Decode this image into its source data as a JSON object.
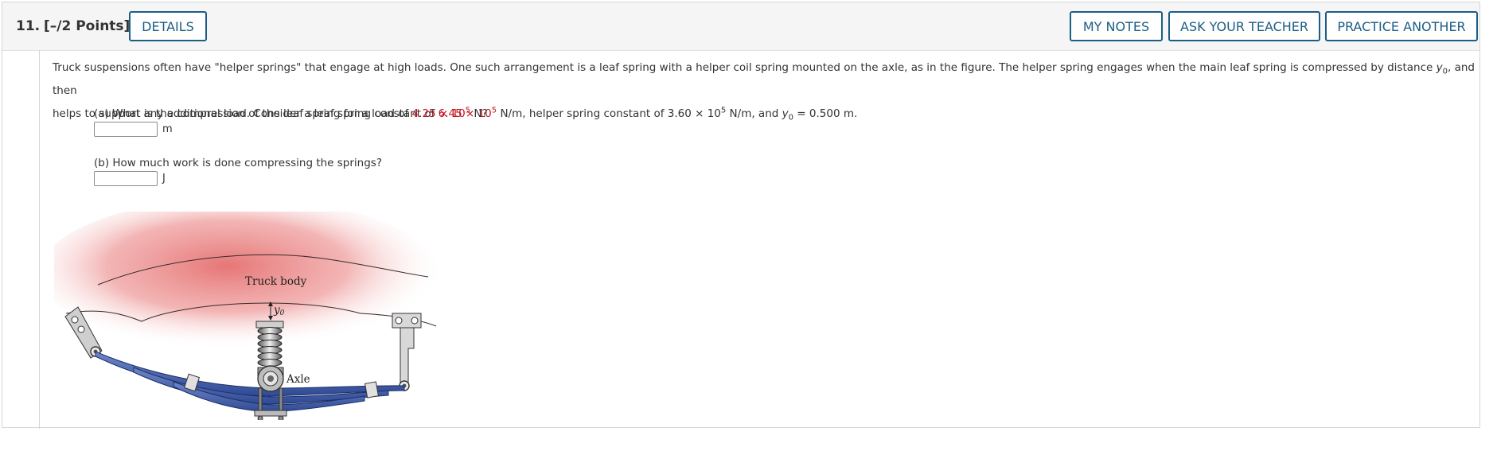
{
  "header": {
    "number": "11.",
    "points": "[–/2 Points]",
    "details_label": "DETAILS",
    "my_notes_label": "MY NOTES",
    "ask_teacher_label": "ASK YOUR TEACHER",
    "practice_label": "PRACTICE ANOTHER"
  },
  "intro": {
    "line1_a": "Truck suspensions often have \"helper springs\" that engage at high loads. One such arrangement is a leaf spring with a helper coil spring mounted on the axle, as in the figure. The helper spring engages when the main leaf spring is compressed by distance ",
    "y_symbol": "y",
    "y_sub": "0",
    "line1_b": ", and then",
    "line2_a": "helps to support any additional load. Consider a leaf spring constant of ",
    "leaf_k_mantissa": "6.45 × 10",
    "leaf_k_exp": "5",
    "line2_b": " N/m, helper spring constant of 3.60 × 10",
    "helper_k_exp": "5",
    "line2_c": " N/m, and ",
    "line2_d": " = 0.500 m."
  },
  "part_a": {
    "question_a": "(a) What is the compression of the leaf spring for a load of ",
    "load_mantissa": "4.25 × 10",
    "load_exp": "5",
    "question_b": " N?",
    "answer_value": "",
    "unit": "m"
  },
  "part_b": {
    "question": "(b) How much work is done compressing the springs?",
    "answer_value": "",
    "unit": "J"
  },
  "figure": {
    "truck_body_label": "Truck body",
    "y0_label": "y",
    "y0_sub": "0",
    "axle_label": "Axle"
  },
  "colors": {
    "accent": "#1b5e85",
    "highlight": "#c0141e",
    "truck_body": "#e77f7f",
    "leaf_spring": "#4a66b0"
  }
}
